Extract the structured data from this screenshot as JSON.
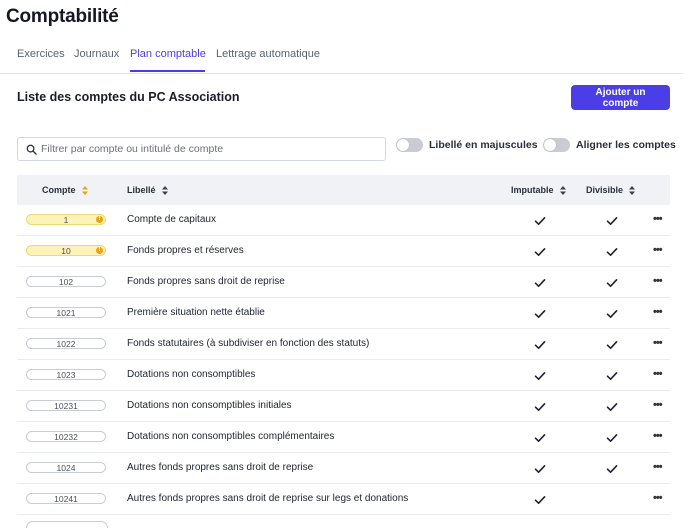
{
  "page": {
    "title": "Comptabilité"
  },
  "tabs": [
    {
      "label": "Exercices",
      "active": false
    },
    {
      "label": "Journaux",
      "active": false
    },
    {
      "label": "Plan comptable",
      "active": true
    },
    {
      "label": "Lettrage automatique",
      "active": false
    }
  ],
  "section": {
    "title": "Liste des comptes du PC Association",
    "add_button": "Ajouter un compte"
  },
  "search": {
    "placeholder": "Filtrer par compte ou intitulé de compte",
    "value": ""
  },
  "toggles": [
    {
      "label": "Libellé en majuscules",
      "on": false
    },
    {
      "label": "Aligner les comptes",
      "on": false
    }
  ],
  "table": {
    "columns": {
      "compte": "Compte",
      "libelle": "Libellé",
      "imputable": "Imputable",
      "divisible": "Divisible"
    },
    "rows": [
      {
        "compte": "1",
        "libelle": "Compte de capitaux",
        "imputable": true,
        "divisible": true,
        "warning": true,
        "warning_symbol": "!"
      },
      {
        "compte": "10",
        "libelle": "Fonds propres et réserves",
        "imputable": true,
        "divisible": true,
        "warning": true,
        "warning_symbol": "!"
      },
      {
        "compte": "102",
        "libelle": "Fonds propres sans droit de reprise",
        "imputable": true,
        "divisible": true,
        "warning": false
      },
      {
        "compte": "1021",
        "libelle": "Première situation nette établie",
        "imputable": true,
        "divisible": true,
        "warning": false
      },
      {
        "compte": "1022",
        "libelle": "Fonds statutaires (à subdiviser en fonction des statuts)",
        "imputable": true,
        "divisible": true,
        "warning": false
      },
      {
        "compte": "1023",
        "libelle": "Dotations non consomptibles",
        "imputable": true,
        "divisible": true,
        "warning": false
      },
      {
        "compte": "10231",
        "libelle": "Dotations non consomptibles initiales",
        "imputable": true,
        "divisible": true,
        "warning": false
      },
      {
        "compte": "10232",
        "libelle": "Dotations non consomptibles complémentaires",
        "imputable": true,
        "divisible": true,
        "warning": false
      },
      {
        "compte": "1024",
        "libelle": "Autres fonds propres sans droit de reprise",
        "imputable": true,
        "divisible": true,
        "warning": false
      },
      {
        "compte": "10241",
        "libelle": "Autres fonds propres sans droit de reprise sur legs et donations",
        "imputable": true,
        "divisible": false,
        "warning": false
      }
    ],
    "more_glyph": "•••"
  },
  "colors": {
    "accent": "#4b3ee6",
    "warning_fill": "#fdf2b8",
    "warning_dot": "#e8a316",
    "header_bg": "#f0f2f6"
  },
  "icons": {
    "search": "search-icon",
    "sort": "sort-icon",
    "check": "check-icon",
    "more": "more-horizontal-icon",
    "warning": "warning-icon"
  }
}
